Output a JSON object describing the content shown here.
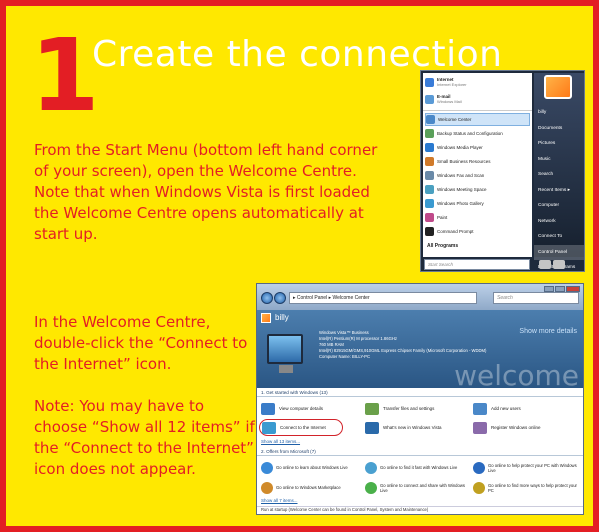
{
  "colors": {
    "frame": "#E31E24",
    "background": "#FFE800",
    "title_text": "#FFFFFF",
    "body_text": "#E31E24"
  },
  "step": {
    "number": "1",
    "title": "Create the connection"
  },
  "paragraphs": {
    "p1": "From the Start Menu (bottom left hand corner of your screen), open the Welcome Centre. Note that when Windows Vista is first loaded the Welcome Centre opens automatically at start up.",
    "p2": "In the Welcome Centre, double-click the “Connect to the Internet” icon.",
    "p3": "Note: You may have to choose “Show all 12 items” if the “Connect to the Internet” icon does not appear."
  },
  "start_menu": {
    "pinned": [
      {
        "label": "Internet",
        "sub": "Internet Explorer",
        "icon": "ie-icon",
        "color": "#3a7cd8"
      },
      {
        "label": "E-mail",
        "sub": "Windows Mail",
        "icon": "mail-icon",
        "color": "#5a9ad6"
      }
    ],
    "recent": [
      {
        "label": "Welcome Center",
        "icon": "welcome-center-icon",
        "color": "#4a88c8",
        "selected": true
      },
      {
        "label": "Backup Status and Configuration",
        "icon": "backup-icon",
        "color": "#5aa05a"
      },
      {
        "label": "Windows Media Player",
        "icon": "media-player-icon",
        "color": "#2a7ad0"
      },
      {
        "label": "Small Business Resources",
        "icon": "business-icon",
        "color": "#d07a2a"
      },
      {
        "label": "Windows Fax and Scan",
        "icon": "fax-icon",
        "color": "#6a8aa8"
      },
      {
        "label": "Windows Meeting Space",
        "icon": "meeting-icon",
        "color": "#4aa0c0"
      },
      {
        "label": "Windows Photo Gallery",
        "icon": "photo-gallery-icon",
        "color": "#3a9ad0"
      },
      {
        "label": "Paint",
        "icon": "paint-icon",
        "color": "#c04a8a"
      },
      {
        "label": "Command Prompt",
        "icon": "command-prompt-icon",
        "color": "#222222"
      }
    ],
    "all_programs": "All Programs",
    "search_placeholder": "Start Search",
    "right_items": [
      "billy",
      "Documents",
      "Pictures",
      "Music",
      "Search",
      "Recent Items",
      "Computer",
      "Network",
      "Connect To",
      "Control Panel",
      "Default Programs",
      "Help and Support"
    ]
  },
  "welcome_window": {
    "address": "▸ Control Panel ▸ Welcome Center",
    "search_placeholder": "Search",
    "user": "billy",
    "specs": [
      "Windows Vista™ Business",
      "Intel(R) Pentium(R) M processor 1.86GHz",
      "760 MB RAM",
      "Intel(R) 82915GM/GMS,910GML Express Chipset Family (Microsoft Corporation - WDDM)",
      "Computer Name: BILLY-PC"
    ],
    "show_more": "Show more details",
    "banner_word": "welcome",
    "section1_title": "1. Get started with Windows (13)",
    "items1": [
      {
        "label": "View computer details",
        "icon": "computer-details-icon",
        "color": "#3a7cc8"
      },
      {
        "label": "Transfer files and settings",
        "icon": "transfer-icon",
        "color": "#6aa04a"
      },
      {
        "label": "Add new users",
        "icon": "users-icon",
        "color": "#4a88c8"
      },
      {
        "label": "Connect to the Internet",
        "icon": "connect-internet-icon",
        "color": "#3a9ad0"
      },
      {
        "label": "What's new in Windows Vista",
        "icon": "whats-new-icon",
        "color": "#2a6aaa"
      },
      {
        "label": "Register Windows online",
        "icon": "register-icon",
        "color": "#8a6aaa"
      }
    ],
    "show_all_link": "Show all 13 items...",
    "section2_title": "2. Offers from Microsoft (7)",
    "items2": [
      {
        "label": "Go online to learn about Windows Live",
        "icon": "windows-live-icon",
        "color": "#3a8ad8"
      },
      {
        "label": "Go online to find it fast with Windows Live",
        "icon": "live-search-icon",
        "color": "#4aa0d0"
      },
      {
        "label": "Go online to help protect your PC with Windows Live",
        "icon": "live-onecare-icon",
        "color": "#2a6ac0"
      },
      {
        "label": "Go online to Windows Marketplace",
        "icon": "marketplace-icon",
        "color": "#d08a2a"
      },
      {
        "label": "Go online to connect and share with Windows Live",
        "icon": "live-messenger-icon",
        "color": "#4ab04a"
      },
      {
        "label": "Go online to find more ways to help protect your PC",
        "icon": "protect-icon",
        "color": "#c0a020"
      }
    ],
    "show_all7": "Show all 7 items...",
    "footer": "Run at startup (Welcome Center can be found in Control Panel, System and Maintenance)"
  }
}
